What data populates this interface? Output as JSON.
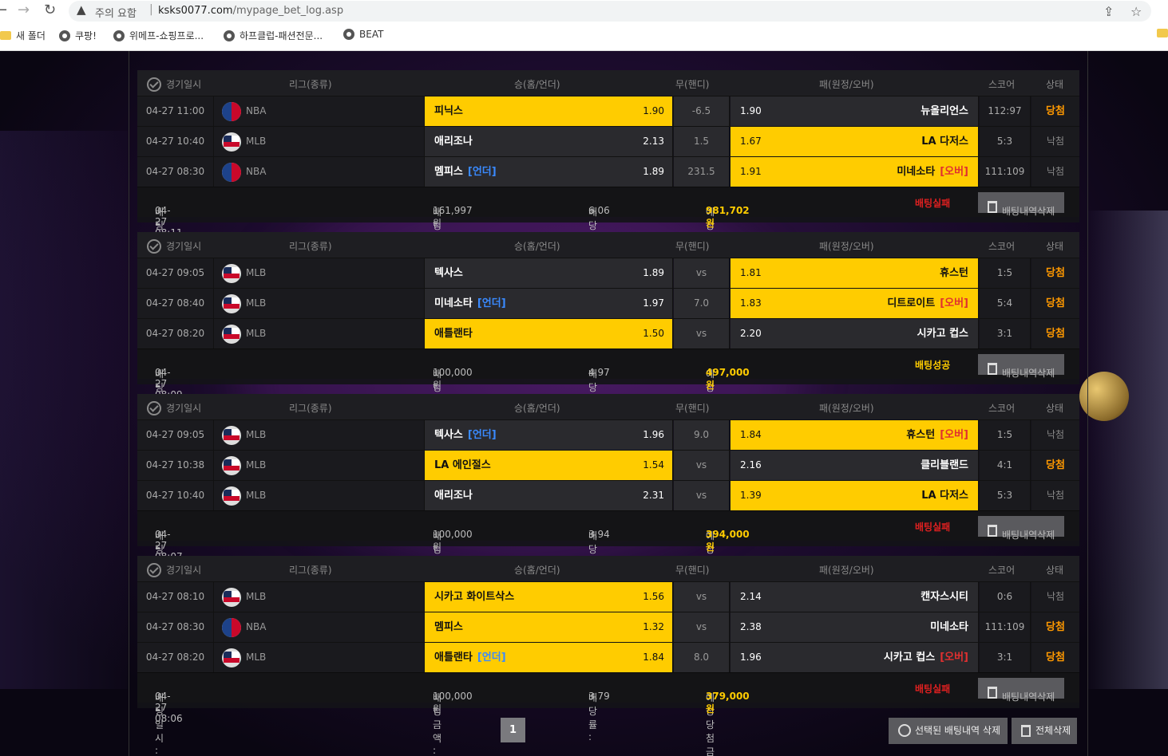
{
  "browser": {
    "warning": "주의 요함",
    "url_host": "ksks0077.com",
    "url_path": "/mypage_bet_log.asp",
    "bookmarks": [
      "새 폴더",
      "쿠팡!",
      "위메프-쇼핑프로...",
      "하프클럽-패션전문...",
      "BEAT"
    ]
  },
  "headers": {
    "time": "경기일시",
    "league": "리그(종류)",
    "home": "승(홈/언더)",
    "draw": "무(핸디)",
    "away": "패(원정/오버)",
    "score": "스코어",
    "status": "상태"
  },
  "footer_labels": {
    "bet_time": "배팅일시 : ",
    "bet_amount": "배팅금액 : ",
    "odds": "배당률 : ",
    "expected": "예상당첨금액 : ",
    "delete": "배팅내역삭제"
  },
  "bets": [
    {
      "rows": [
        {
          "time": "04-27 11:00",
          "league": "NBA",
          "home": "피닉스",
          "home_tag": "",
          "home_odd": "1.90",
          "draw": "-6.5",
          "away": "뉴올리언스",
          "away_tag": "",
          "away_odd": "1.90",
          "score": "112:97",
          "status": "당첨"
        },
        {
          "time": "04-27 10:40",
          "league": "MLB",
          "home": "애리조나",
          "home_tag": "",
          "home_odd": "2.13",
          "draw": "1.5",
          "away": "LA 다저스",
          "away_tag": "",
          "away_odd": "1.67",
          "score": "5:3",
          "status": "낙첨"
        },
        {
          "time": "04-27 08:30",
          "league": "NBA",
          "home": "멤피스",
          "home_tag": "[언더]",
          "home_odd": "1.89",
          "draw": "231.5",
          "away": "미네소타",
          "away_tag": "[오버]",
          "away_odd": "1.91",
          "score": "111:109",
          "status": "낙첨"
        }
      ],
      "bet_time": "04-27 08:11",
      "bet_amount": "161,997원",
      "odds": "6.06",
      "expected": "981,702원",
      "result": "배팅실패"
    },
    {
      "rows": [
        {
          "time": "04-27 09:05",
          "league": "MLB",
          "home": "텍사스",
          "home_tag": "",
          "home_odd": "1.89",
          "draw": "vs",
          "away": "휴스턴",
          "away_tag": "",
          "away_odd": "1.81",
          "score": "1:5",
          "status": "당첨"
        },
        {
          "time": "04-27 08:40",
          "league": "MLB",
          "home": "미네소타",
          "home_tag": "[언더]",
          "home_odd": "1.97",
          "draw": "7.0",
          "away": "디트로이트",
          "away_tag": "[오버]",
          "away_odd": "1.83",
          "score": "5:4",
          "status": "당첨"
        },
        {
          "time": "04-27 08:20",
          "league": "MLB",
          "home": "애틀랜타",
          "home_tag": "",
          "home_odd": "1.50",
          "draw": "vs",
          "away": "시카고 컵스",
          "away_tag": "",
          "away_odd": "2.20",
          "score": "3:1",
          "status": "당첨"
        }
      ],
      "bet_time": "04-27 08:09",
      "bet_amount": "100,000원",
      "odds": "4.97",
      "expected": "497,000원",
      "result": "배팅성공"
    },
    {
      "rows": [
        {
          "time": "04-27 09:05",
          "league": "MLB",
          "home": "텍사스",
          "home_tag": "[언더]",
          "home_odd": "1.96",
          "draw": "9.0",
          "away": "휴스턴",
          "away_tag": "[오버]",
          "away_odd": "1.84",
          "score": "1:5",
          "status": "낙첨"
        },
        {
          "time": "04-27 10:38",
          "league": "MLB",
          "home": "LA 에인절스",
          "home_tag": "",
          "home_odd": "1.54",
          "draw": "vs",
          "away": "클리블랜드",
          "away_tag": "",
          "away_odd": "2.16",
          "score": "4:1",
          "status": "당첨"
        },
        {
          "time": "04-27 10:40",
          "league": "MLB",
          "home": "애리조나",
          "home_tag": "",
          "home_odd": "2.31",
          "draw": "vs",
          "away": "LA 다저스",
          "away_tag": "",
          "away_odd": "1.39",
          "score": "5:3",
          "status": "낙첨"
        }
      ],
      "bet_time": "04-27 08:07",
      "bet_amount": "100,000원",
      "odds": "3.94",
      "expected": "394,000원",
      "result": "배팅실패"
    },
    {
      "rows": [
        {
          "time": "04-27 08:10",
          "league": "MLB",
          "home": "시카고 화이트삭스",
          "home_tag": "",
          "home_odd": "1.56",
          "draw": "vs",
          "away": "캔자스시티",
          "away_tag": "",
          "away_odd": "2.14",
          "score": "0:6",
          "status": "낙첨"
        },
        {
          "time": "04-27 08:30",
          "league": "NBA",
          "home": "멤피스",
          "home_tag": "",
          "home_odd": "1.32",
          "draw": "vs",
          "away": "미네소타",
          "away_tag": "",
          "away_odd": "2.38",
          "score": "111:109",
          "status": "당첨"
        },
        {
          "time": "04-27 08:20",
          "league": "MLB",
          "home": "애틀랜타",
          "home_tag": "[언더]",
          "home_odd": "1.84",
          "draw": "8.0",
          "away": "시카고 컵스",
          "away_tag": "[오버]",
          "away_odd": "1.96",
          "score": "3:1",
          "status": "당첨"
        }
      ],
      "bet_time": "04-27 08:06",
      "bet_amount": "100,000원",
      "odds": "3.79",
      "expected": "379,000원",
      "result": "배팅실패"
    }
  ],
  "picks": [
    [
      "home",
      "away",
      "away"
    ],
    [
      "away",
      "away",
      "home"
    ],
    [
      "away",
      "home",
      "away"
    ],
    [
      "home",
      "home",
      "home"
    ]
  ],
  "pagination": {
    "current": "1"
  },
  "bottom_buttons": {
    "delete_selected": "선택된 배팅내역 삭제",
    "delete_all": "전체삭제"
  },
  "colors": {
    "win_cell": "#ffcc00",
    "fail": "#e02020",
    "hit": "#ff9900"
  }
}
